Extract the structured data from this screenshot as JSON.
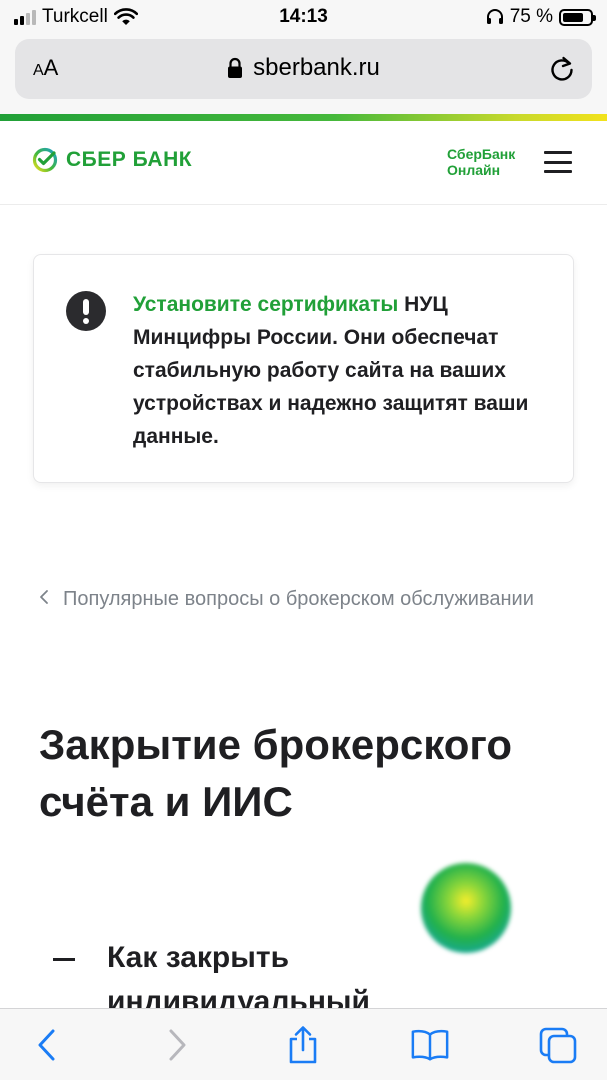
{
  "status_bar": {
    "carrier": "Turkcell",
    "time": "14:13",
    "battery_percent": "75 %",
    "battery_level": 0.75,
    "signal_bars_active": 2,
    "signal_bars_total": 4,
    "icons": [
      "signal-icon",
      "wifi-icon",
      "headphones-icon",
      "battery-icon"
    ]
  },
  "browser": {
    "reader_button": "AA",
    "url": "sberbank.ru",
    "icons": [
      "lock-icon",
      "reload-icon"
    ]
  },
  "header": {
    "logo_text": "СБЕР БАНК",
    "online_link": "СберБанк Онлайн",
    "online_link_line1": "СберБанк",
    "online_link_line2": "Онлайн",
    "icons": [
      "sber-logo-icon",
      "menu-icon"
    ],
    "brand_color": "#21a038"
  },
  "notice": {
    "link_text": "Установите сертификаты",
    "body_text": " НУЦ Минцифры России. Они обеспечат стабильную работу сайта на ваших устройствах и надежно защитят ваши данные.",
    "icon": "exclamation-icon"
  },
  "breadcrumb": {
    "text": "Популярные вопросы о брокерском обслуживании",
    "icon": "chevron-left-icon"
  },
  "main": {
    "title": "Закрытие брокерского счёта и ИИС",
    "faq_item_title": "Как закрыть индивидуальный",
    "assistant_icon": "salute-assistant-icon"
  },
  "toolbar": {
    "icons": [
      "back-icon",
      "forward-icon",
      "share-icon",
      "bookmarks-icon",
      "tabs-icon"
    ],
    "accent_color": "#1a7cf5"
  }
}
